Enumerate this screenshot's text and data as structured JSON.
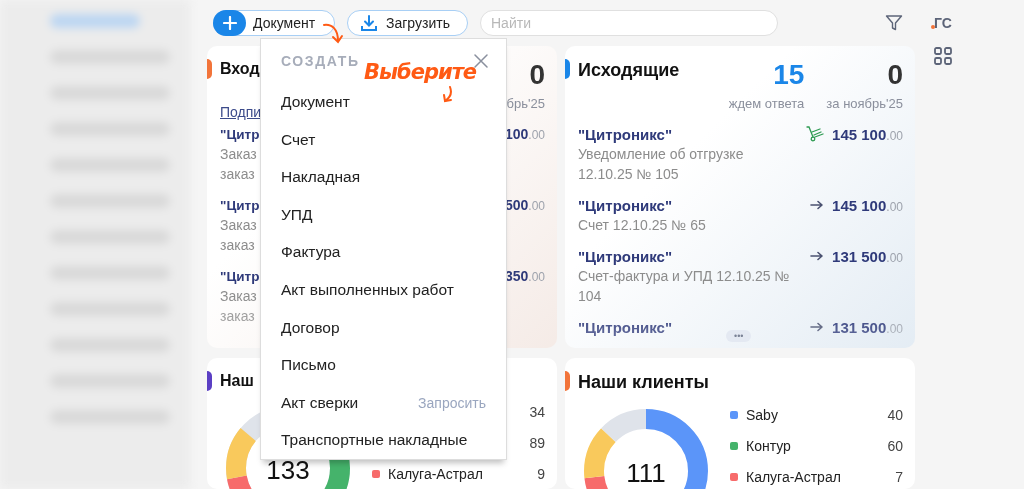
{
  "toolbar": {
    "create_button": {
      "label": "Документ"
    },
    "upload_button": {
      "label": "Загрузить"
    },
    "search": {
      "placeholder": "Найти"
    },
    "user_initials": "ГС"
  },
  "document_cards": [
    {
      "title": "Вход",
      "color": "#f2743a",
      "counters": [
        {
          "kind": "total",
          "value": "0",
          "label": "брь'25"
        }
      ],
      "link": "Подпи",
      "rows": [
        {
          "name": "\"Цитр",
          "lines": [
            "Заказ",
            "заказ"
          ],
          "kind": "plain",
          "amount": "100",
          "cents": ".00"
        },
        {
          "name": "\"Цитр",
          "lines": [
            "Заказ",
            "заказ"
          ],
          "kind": "plain",
          "amount": "500",
          "cents": ".00"
        },
        {
          "name": "\"Цитр",
          "lines": [
            "Заказ",
            "заказ"
          ],
          "kind": "plain",
          "amount": "350",
          "cents": ".00"
        }
      ]
    },
    {
      "title": "Исходящие",
      "color": "#1a86e8",
      "counters": [
        {
          "kind": "waiting",
          "value": "15",
          "label": "ждем ответа"
        },
        {
          "kind": "total",
          "value": "0",
          "label": "за ноябрь'25"
        }
      ],
      "rows": [
        {
          "name": "\"Цитроникс\"",
          "lines": [
            "Уведомление об отгрузке",
            "12.10.25 № 105"
          ],
          "kind": "shipment",
          "amount": "145 100",
          "cents": ".00"
        },
        {
          "name": "\"Цитроникс\"",
          "lines": [
            "Счет 12.10.25 № 65"
          ],
          "kind": "sent",
          "amount": "145 100",
          "cents": ".00"
        },
        {
          "name": "\"Цитроникс\"",
          "lines": [
            "Счет-фактура и УПД 12.10.25 №",
            "104"
          ],
          "kind": "sent",
          "amount": "131 500",
          "cents": ".00"
        },
        {
          "name": "\"Цитроникс\"",
          "lines": [],
          "kind": "sent",
          "amount": "131 500",
          "cents": ".00"
        }
      ],
      "more": "•••"
    }
  ],
  "client_cards": [
    {
      "title": "Наш",
      "color": "#5b3fc4",
      "total": "133",
      "legend": [
        {
          "count": "34"
        },
        {
          "count": "89"
        },
        {
          "name": "Калуга-Астрал",
          "color": "#f76b6b",
          "count": "9"
        }
      ]
    },
    {
      "title": "Наши клиенты",
      "color": "#f2743a",
      "total": "111",
      "legend": [
        {
          "name": "Saby",
          "color": "#5b95f9",
          "count": "40"
        },
        {
          "name": "Контур",
          "color": "#45b36b",
          "count": "60"
        },
        {
          "name": "Калуга-Астрал",
          "color": "#f76b6b",
          "count": "7"
        }
      ]
    }
  ],
  "create_menu": {
    "header": "СОЗДАТЬ",
    "items": [
      {
        "label": "Документ"
      },
      {
        "label": "Счет"
      },
      {
        "label": "Накладная"
      },
      {
        "label": "УПД"
      },
      {
        "label": "Фактура"
      },
      {
        "label": "Акт выполненных работ"
      },
      {
        "label": "Договор"
      },
      {
        "label": "Письмо"
      },
      {
        "label": "Акт сверки",
        "action": "Запросить"
      },
      {
        "label": "Транспортные накладные"
      }
    ]
  },
  "annotation": {
    "text": "Выберите"
  }
}
